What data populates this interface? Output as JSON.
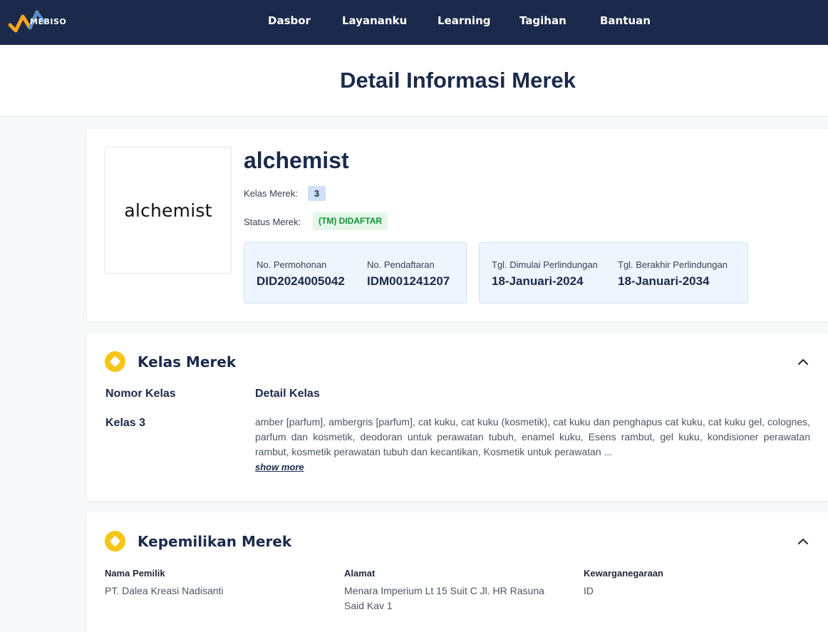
{
  "app": {
    "logo_text": "MEBISO"
  },
  "nav": {
    "items": [
      "Dasbor",
      "Layananku",
      "Learning",
      "Tagihan",
      "Bantuan"
    ]
  },
  "page": {
    "title": "Detail Informasi Merek"
  },
  "brand": {
    "logo_text": "alchemist",
    "name": "alchemist",
    "kelas_label": "Kelas Merek:",
    "kelas_value": "3",
    "status_label": "Status Merek:",
    "status_value": "(TM) DIDAFTAR",
    "permohonan_label": "No. Permohonan",
    "permohonan_value": "DID2024005042",
    "pendaftaran_label": "No. Pendaftaran",
    "pendaftaran_value": "IDM001241207",
    "mulai_label": "Tgl. Dimulai Perlindungan",
    "mulai_value": "18-Januari-2024",
    "berakhir_label": "Tgl. Berakhir Perlindungan",
    "berakhir_value": "18-Januari-2034"
  },
  "kelas_section": {
    "title": "Kelas Merek",
    "col_nomor": "Nomor Kelas",
    "col_detail": "Detail Kelas",
    "row_kelas": "Kelas 3",
    "row_detail": "amber [parfum], ambergris [parfum], cat kuku, cat kuku (kosmetik), cat kuku dan penghapus cat kuku, cat kuku gel, colognes, parfum dan kosmetik, deodoran untuk perawatan tubuh, enamel kuku, Esens rambut, gel kuku, kondisioner perawatan rambut, kosmetik perawatan tubuh dan kecantikan, Kosmetik untuk perawatan ...",
    "show_more": "show more"
  },
  "pemilik_section": {
    "title": "Kepemilikan Merek",
    "nama_label": "Nama Pemilik",
    "nama_value": "PT. Dalea Kreasi Nadisanti",
    "alamat_label": "Alamat",
    "alamat_value_line1": "Menara Imperium Lt 15 Suit C Jl. HR Rasuna",
    "alamat_value_line2": "Said Kav 1",
    "warga_label": "Kewarganegaraan",
    "warga_value": "ID"
  },
  "colors": {
    "navy": "#1b2a4a",
    "accent_yellow": "#f5c518",
    "status_green": "#17903a",
    "info_bg": "#eef5fd"
  }
}
